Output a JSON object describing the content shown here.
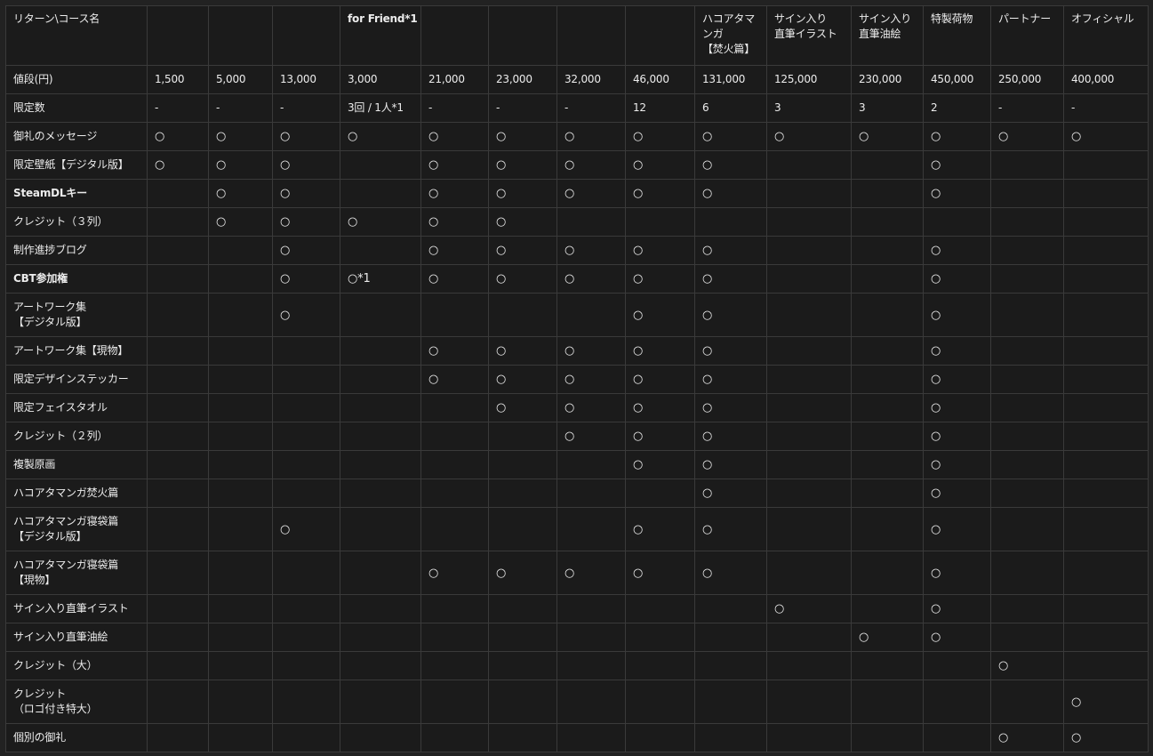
{
  "corner_label": "リターン\\コース名",
  "columns": [
    {
      "name": []
    },
    {
      "name": []
    },
    {
      "name": []
    },
    {
      "name": [
        "for Friend*1"
      ],
      "bold": true
    },
    {
      "name": []
    },
    {
      "name": []
    },
    {
      "name": []
    },
    {
      "name": []
    },
    {
      "name": [
        "ハコアタマ",
        "ンガ",
        "【焚火篇】"
      ]
    },
    {
      "name": [
        "サイン入り",
        "直筆イラスト"
      ]
    },
    {
      "name": [
        "サイン入り",
        "直筆油絵"
      ]
    },
    {
      "name": [
        "特製荷物"
      ]
    },
    {
      "name": [
        "パートナー"
      ]
    },
    {
      "name": [
        "オフィシャル"
      ]
    }
  ],
  "price_row": {
    "label": "値段(円)",
    "cells": [
      "1,500",
      "5,000",
      "13,000",
      "3,000",
      "21,000",
      "23,000",
      "32,000",
      "46,000",
      "131,000",
      "125,000",
      "230,000",
      "450,000",
      "250,000",
      "400,000"
    ]
  },
  "limit_row": {
    "label": "限定数",
    "cells": [
      "-",
      "-",
      "-",
      "3回 / 1人*1",
      "-",
      "-",
      "-",
      "12",
      "6",
      "3",
      "3",
      "2",
      "-",
      "-"
    ]
  },
  "reward_rows": [
    {
      "label": [
        "御礼のメッセージ"
      ],
      "cells": [
        "○",
        "○",
        "○",
        "○",
        "○",
        "○",
        "○",
        "○",
        "○",
        "○",
        "○",
        "○",
        "○",
        "○"
      ]
    },
    {
      "label": [
        "限定壁紙【デジタル版】"
      ],
      "cells": [
        "○",
        "○",
        "○",
        "",
        "○",
        "○",
        "○",
        "○",
        "○",
        "",
        "",
        "○",
        "",
        ""
      ]
    },
    {
      "label": [
        "SteamDLキー"
      ],
      "bold": true,
      "cells": [
        "",
        "○",
        "○",
        "",
        "○",
        "○",
        "○",
        "○",
        "○",
        "",
        "",
        "○",
        "",
        ""
      ]
    },
    {
      "label": [
        "クレジット（３列）"
      ],
      "cells": [
        "",
        "○",
        "○",
        "○",
        "○",
        "○",
        "",
        "",
        "",
        "",
        "",
        "",
        "",
        ""
      ]
    },
    {
      "label": [
        "制作進捗ブログ"
      ],
      "cells": [
        "",
        "",
        "○",
        "",
        "○",
        "○",
        "○",
        "○",
        "○",
        "",
        "",
        "○",
        "",
        ""
      ]
    },
    {
      "label": [
        "CBT参加権"
      ],
      "bold": true,
      "cells": [
        "",
        "",
        "○",
        "○*1",
        "○",
        "○",
        "○",
        "○",
        "○",
        "",
        "",
        "○",
        "",
        ""
      ]
    },
    {
      "label": [
        "アートワーク集",
        "【デジタル版】"
      ],
      "tall": true,
      "cells": [
        "",
        "",
        "○",
        "",
        "",
        "",
        "",
        "○",
        "○",
        "",
        "",
        "○",
        "",
        ""
      ]
    },
    {
      "label": [
        "アートワーク集【現物】"
      ],
      "cells": [
        "",
        "",
        "",
        "",
        "○",
        "○",
        "○",
        "○",
        "○",
        "",
        "",
        "○",
        "",
        ""
      ]
    },
    {
      "label": [
        "限定デザインステッカー"
      ],
      "cells": [
        "",
        "",
        "",
        "",
        "○",
        "○",
        "○",
        "○",
        "○",
        "",
        "",
        "○",
        "",
        ""
      ]
    },
    {
      "label": [
        "限定フェイスタオル"
      ],
      "cells": [
        "",
        "",
        "",
        "",
        "",
        "○",
        "○",
        "○",
        "○",
        "",
        "",
        "○",
        "",
        ""
      ]
    },
    {
      "label": [
        "クレジット（２列）"
      ],
      "cells": [
        "",
        "",
        "",
        "",
        "",
        "",
        "○",
        "○",
        "○",
        "",
        "",
        "○",
        "",
        ""
      ]
    },
    {
      "label": [
        "複製原画"
      ],
      "cells": [
        "",
        "",
        "",
        "",
        "",
        "",
        "",
        "○",
        "○",
        "",
        "",
        "○",
        "",
        ""
      ]
    },
    {
      "label": [
        "ハコアタマンガ焚火篇"
      ],
      "cells": [
        "",
        "",
        "",
        "",
        "",
        "",
        "",
        "",
        "○",
        "",
        "",
        "○",
        "",
        ""
      ]
    },
    {
      "label": [
        "ハコアタマンガ寝袋篇",
        "【デジタル版】"
      ],
      "tall": true,
      "cells": [
        "",
        "",
        "○",
        "",
        "",
        "",
        "",
        "○",
        "○",
        "",
        "",
        "○",
        "",
        ""
      ]
    },
    {
      "label": [
        "ハコアタマンガ寝袋篇",
        "【現物】"
      ],
      "tall": true,
      "cells": [
        "",
        "",
        "",
        "",
        "○",
        "○",
        "○",
        "○",
        "○",
        "",
        "",
        "○",
        "",
        ""
      ]
    },
    {
      "label": [
        "サイン入り直筆イラスト"
      ],
      "cells": [
        "",
        "",
        "",
        "",
        "",
        "",
        "",
        "",
        "",
        "○",
        "",
        "○",
        "",
        ""
      ]
    },
    {
      "label": [
        "サイン入り直筆油絵"
      ],
      "cells": [
        "",
        "",
        "",
        "",
        "",
        "",
        "",
        "",
        "",
        "",
        "○",
        "○",
        "",
        ""
      ]
    },
    {
      "label": [
        "クレジット（大）"
      ],
      "cells": [
        "",
        "",
        "",
        "",
        "",
        "",
        "",
        "",
        "",
        "",
        "",
        "",
        "○",
        ""
      ]
    },
    {
      "label": [
        "クレジット",
        "（ロゴ付き特大）"
      ],
      "tall": true,
      "cells": [
        "",
        "",
        "",
        "",
        "",
        "",
        "",
        "",
        "",
        "",
        "",
        "",
        "",
        "○"
      ]
    },
    {
      "label": [
        "個別の御礼"
      ],
      "cells": [
        "",
        "",
        "",
        "",
        "",
        "",
        "",
        "",
        "",
        "",
        "",
        "",
        "○",
        "○"
      ]
    }
  ]
}
